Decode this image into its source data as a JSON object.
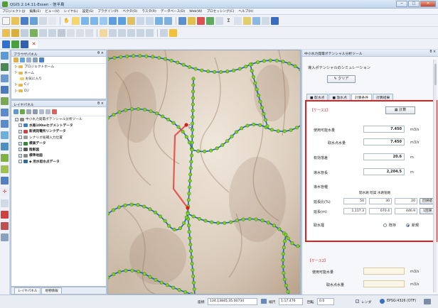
{
  "window": {
    "title": "QGIS 2.14.11-Essen - 信半島",
    "controls": {
      "minimize": "─",
      "maximize": "□",
      "close": "✕"
    }
  },
  "menu": [
    "プロジェクト(J)",
    "編集(E)",
    "ビュー(V)",
    "レイヤ(L)",
    "設定(S)",
    "プラグイン(P)",
    "ベクタ(O)",
    "ラスタ(R)",
    "データベース(D)",
    "Web(W)",
    "プロセッシング(C)",
    "ヘルプ(H)"
  ],
  "browser_panel": {
    "title": "ブラウザパネル",
    "close": "θ ×",
    "items": [
      {
        "label": "プロジェクトホーム",
        "expander": "▷"
      },
      {
        "label": "ホーム",
        "expander": "▷"
      },
      {
        "label": "お気に入り",
        "expander": ""
      },
      {
        "label": "C:/",
        "expander": "▷"
      },
      {
        "label": "D:/",
        "expander": "▷"
      }
    ]
  },
  "layer_panel": {
    "title": "レイヤパネル",
    "close": "θ ×",
    "items": [
      {
        "label": "中小水力発電ポテンシャル分析ツール",
        "check": "✓",
        "bold": false,
        "color": "#888888"
      },
      {
        "label": "水路100mセグメントデータ",
        "check": "✓",
        "bold": true,
        "color": "#3a7ad0"
      },
      {
        "label": "新規発電所リンクデータ",
        "check": "✓",
        "bold": true,
        "color": "#d04040"
      },
      {
        "label": "シナリオ候補入力位置",
        "check": "",
        "bold": false,
        "color": "#9a9a9a"
      },
      {
        "label": "標高データ",
        "check": "✓",
        "bold": true,
        "color": "#2e8a2e"
      },
      {
        "label": "陰影図",
        "check": "✓",
        "bold": true,
        "color": "#555555"
      },
      {
        "label": "標準地図",
        "check": "✓",
        "bold": true,
        "color": "#888888"
      },
      {
        "label": "◆ 用水取水点データ",
        "check": "",
        "bold": true,
        "color": "#2a6a9a"
      }
    ]
  },
  "bottom_tabs": [
    "レイヤパネル",
    "地物情報"
  ],
  "right_panel": {
    "title": "中小水力発電ポテンシャル分析ツール",
    "close": "θ ×",
    "subtitle": "導入ポテンシャルのシミュレーション",
    "clear_button": "✎ クリア",
    "tabs": [
      "■ 取水点",
      "■ 放水点",
      "計算条件",
      "計算結果"
    ],
    "case1": {
      "title": "【ケース1】",
      "calc_button": "▦ 計算",
      "available_flow_label": "使用可能水量",
      "available_flow_value": "7.450",
      "available_flow_unit": "m3/s",
      "intake_flow_label": "取水点水量",
      "intake_flow_value": "7.450",
      "intake_flow_unit": "m3/s",
      "effective_head_label": "有効落差",
      "effective_head_value": "20.6",
      "effective_head_unit": "m",
      "penstock_label": "導水管長",
      "penstock_value": "2,204.5",
      "penstock_unit": "m",
      "pipe_label": "導水管種",
      "pipe_header": "開水路  暗渠  水路管路",
      "ratio_label": "延長比(%)",
      "ratio_values": [
        "50",
        "30",
        "20"
      ],
      "ratio_reset": "回帰値",
      "length_label": "延長(m)",
      "length_values": [
        "1,117.3",
        "670.4",
        "446.9"
      ],
      "length_reset": "1回帰",
      "intake_type_label": "取水堰",
      "intake_type_options": [
        "既存",
        "新規"
      ],
      "intake_type_selected": "新規"
    },
    "case2": {
      "title": "【ケース2】",
      "available_flow_label": "使用可能水量",
      "available_flow_unit": "m3/s",
      "intake_flow_label": "取水点水量",
      "intake_flow_unit": "m3/s"
    }
  },
  "statusbar": {
    "coord_label": "座標",
    "coord_value": "134.13845,35.00734",
    "scale_label": "縮尺",
    "scale_value": "1:17,476",
    "rotation_label": "回転",
    "rotation_value": "0.0",
    "render_label": "レンダ",
    "crs": "EPSG:4326 (OTF)"
  },
  "colors": {
    "accent_red": "#e02020",
    "stream_blue": "#2060d0",
    "node_green": "#7ed321",
    "terrain_light": "#eadfd2"
  }
}
